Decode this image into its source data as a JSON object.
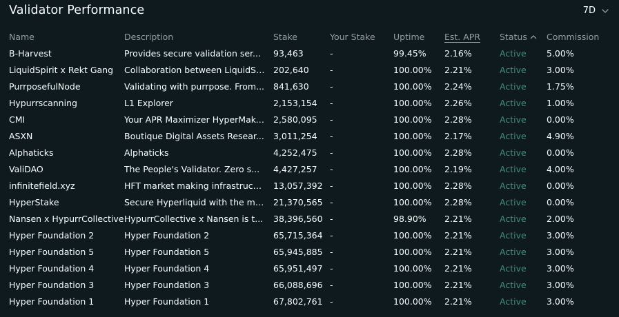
{
  "header": {
    "title": "Validator Performance",
    "period": "7D"
  },
  "columns": {
    "name": "Name",
    "description": "Description",
    "stake": "Stake",
    "your_stake": "Your Stake",
    "uptime": "Uptime",
    "est_apr": "Est. APR",
    "status": "Status",
    "commission": "Commission"
  },
  "rows": [
    {
      "name": "B-Harvest",
      "description": "Provides secure validation ser...",
      "stake": "93,463",
      "your_stake": "-",
      "uptime": "99.45%",
      "apr": "2.16%",
      "status": "Active",
      "commission": "5.00%"
    },
    {
      "name": "LiquidSpirit x Rekt Gang",
      "description": "Collaboration between LiquidSp...",
      "stake": "202,640",
      "your_stake": "-",
      "uptime": "100.00%",
      "apr": "2.21%",
      "status": "Active",
      "commission": "3.00%"
    },
    {
      "name": "PurrposefulNode",
      "description": "Validating with purrpose. From...",
      "stake": "841,630",
      "your_stake": "-",
      "uptime": "100.00%",
      "apr": "2.24%",
      "status": "Active",
      "commission": "1.75%"
    },
    {
      "name": "Hypurrscanning",
      "description": "L1 Explorer",
      "stake": "2,153,154",
      "your_stake": "-",
      "uptime": "100.00%",
      "apr": "2.26%",
      "status": "Active",
      "commission": "1.00%"
    },
    {
      "name": "CMI",
      "description": "Your APR Maximizer HyperMaker....",
      "stake": "2,580,095",
      "your_stake": "-",
      "uptime": "100.00%",
      "apr": "2.28%",
      "status": "Active",
      "commission": "0.00%"
    },
    {
      "name": "ASXN",
      "description": "Boutique Digital Assets Resear...",
      "stake": "3,011,254",
      "your_stake": "-",
      "uptime": "100.00%",
      "apr": "2.17%",
      "status": "Active",
      "commission": "4.90%"
    },
    {
      "name": "Alphaticks",
      "description": "Alphaticks",
      "stake": "4,252,475",
      "your_stake": "-",
      "uptime": "100.00%",
      "apr": "2.28%",
      "status": "Active",
      "commission": "0.00%"
    },
    {
      "name": "ValiDAO",
      "description": "The People's Validator. Zero s...",
      "stake": "4,427,257",
      "your_stake": "-",
      "uptime": "100.00%",
      "apr": "2.19%",
      "status": "Active",
      "commission": "4.00%"
    },
    {
      "name": "infinitefield.xyz",
      "description": "HFT market making infrastructu...",
      "stake": "13,057,392",
      "your_stake": "-",
      "uptime": "100.00%",
      "apr": "2.28%",
      "status": "Active",
      "commission": "0.00%"
    },
    {
      "name": "HyperStake",
      "description": "Secure Hyperliquid with the mo...",
      "stake": "21,370,565",
      "your_stake": "-",
      "uptime": "100.00%",
      "apr": "2.28%",
      "status": "Active",
      "commission": "0.00%"
    },
    {
      "name": "Nansen x HypurrCollective",
      "description": "HypurrCollective x Nansen is t...",
      "stake": "38,396,560",
      "your_stake": "-",
      "uptime": "98.90%",
      "apr": "2.21%",
      "status": "Active",
      "commission": "2.00%"
    },
    {
      "name": "Hyper Foundation 2",
      "description": "Hyper Foundation 2",
      "stake": "65,715,364",
      "your_stake": "-",
      "uptime": "100.00%",
      "apr": "2.21%",
      "status": "Active",
      "commission": "3.00%"
    },
    {
      "name": "Hyper Foundation 5",
      "description": "Hyper Foundation 5",
      "stake": "65,945,885",
      "your_stake": "-",
      "uptime": "100.00%",
      "apr": "2.21%",
      "status": "Active",
      "commission": "3.00%"
    },
    {
      "name": "Hyper Foundation 4",
      "description": "Hyper Foundation 4",
      "stake": "65,951,497",
      "your_stake": "-",
      "uptime": "100.00%",
      "apr": "2.21%",
      "status": "Active",
      "commission": "3.00%"
    },
    {
      "name": "Hyper Foundation 3",
      "description": "Hyper Foundation 3",
      "stake": "66,088,696",
      "your_stake": "-",
      "uptime": "100.00%",
      "apr": "2.21%",
      "status": "Active",
      "commission": "3.00%"
    },
    {
      "name": "Hyper Foundation 1",
      "description": "Hyper Foundation 1",
      "stake": "67,802,761",
      "your_stake": "-",
      "uptime": "100.00%",
      "apr": "2.21%",
      "status": "Active",
      "commission": "3.00%"
    }
  ],
  "icons": {
    "period_dropdown": "chevron-down-icon",
    "status_sort": "caret-up-icon"
  },
  "colors": {
    "background": "#0f1a1f",
    "text": "#f6fefd",
    "muted": "#949e9c",
    "status_active": "#3c8f7e"
  }
}
